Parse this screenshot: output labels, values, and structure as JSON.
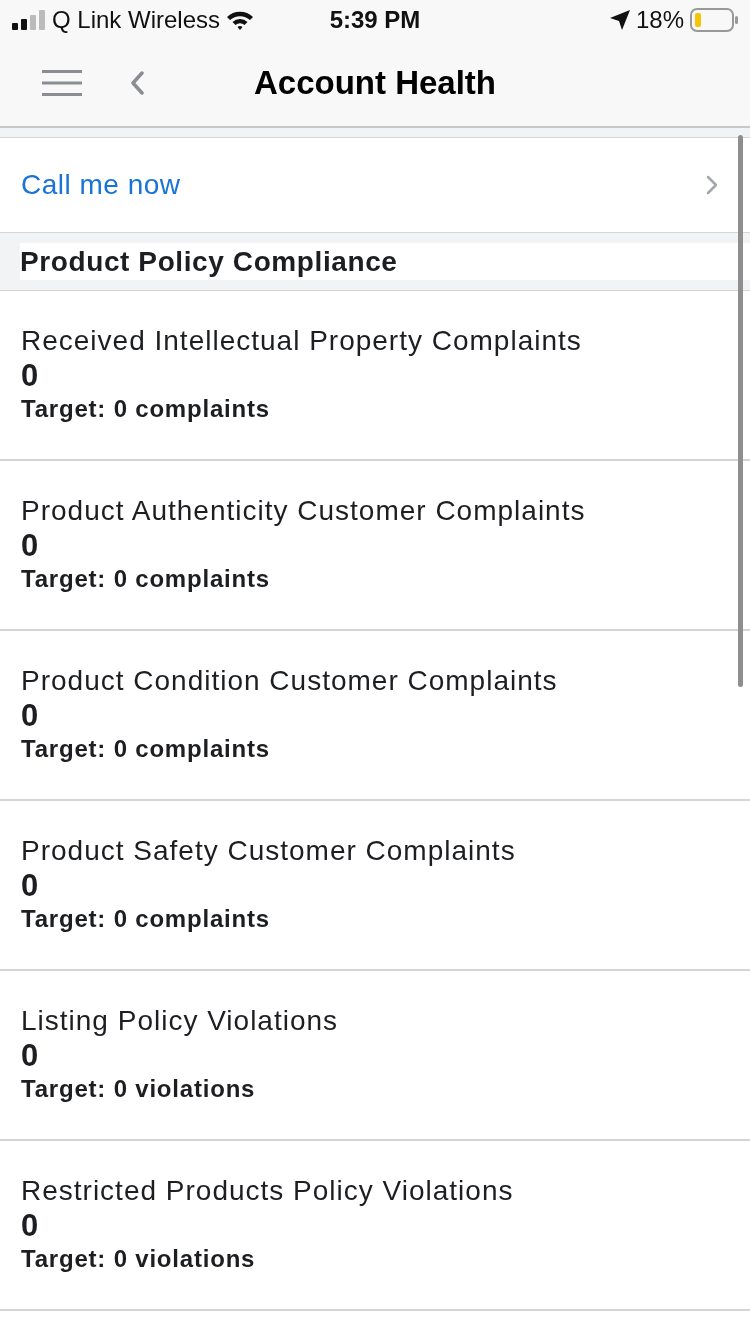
{
  "status_bar": {
    "carrier": "Q Link Wireless",
    "time": "5:39 PM",
    "battery": "18%"
  },
  "nav_bar": {
    "title": "Account Health"
  },
  "call_row": {
    "label": "Call me now"
  },
  "section": {
    "title": "Product Policy Compliance"
  },
  "metrics": [
    {
      "title": "Received Intellectual Property Complaints",
      "value": "0",
      "target": "Target: 0 complaints"
    },
    {
      "title": "Product Authenticity Customer Complaints",
      "value": "0",
      "target": "Target: 0 complaints"
    },
    {
      "title": "Product Condition Customer Complaints",
      "value": "0",
      "target": "Target: 0 complaints"
    },
    {
      "title": "Product Safety Customer Complaints",
      "value": "0",
      "target": "Target: 0 complaints"
    },
    {
      "title": "Listing Policy Violations",
      "value": "0",
      "target": "Target: 0 violations"
    },
    {
      "title": "Restricted Products Policy Violations",
      "value": "0",
      "target": "Target: 0 violations"
    }
  ]
}
